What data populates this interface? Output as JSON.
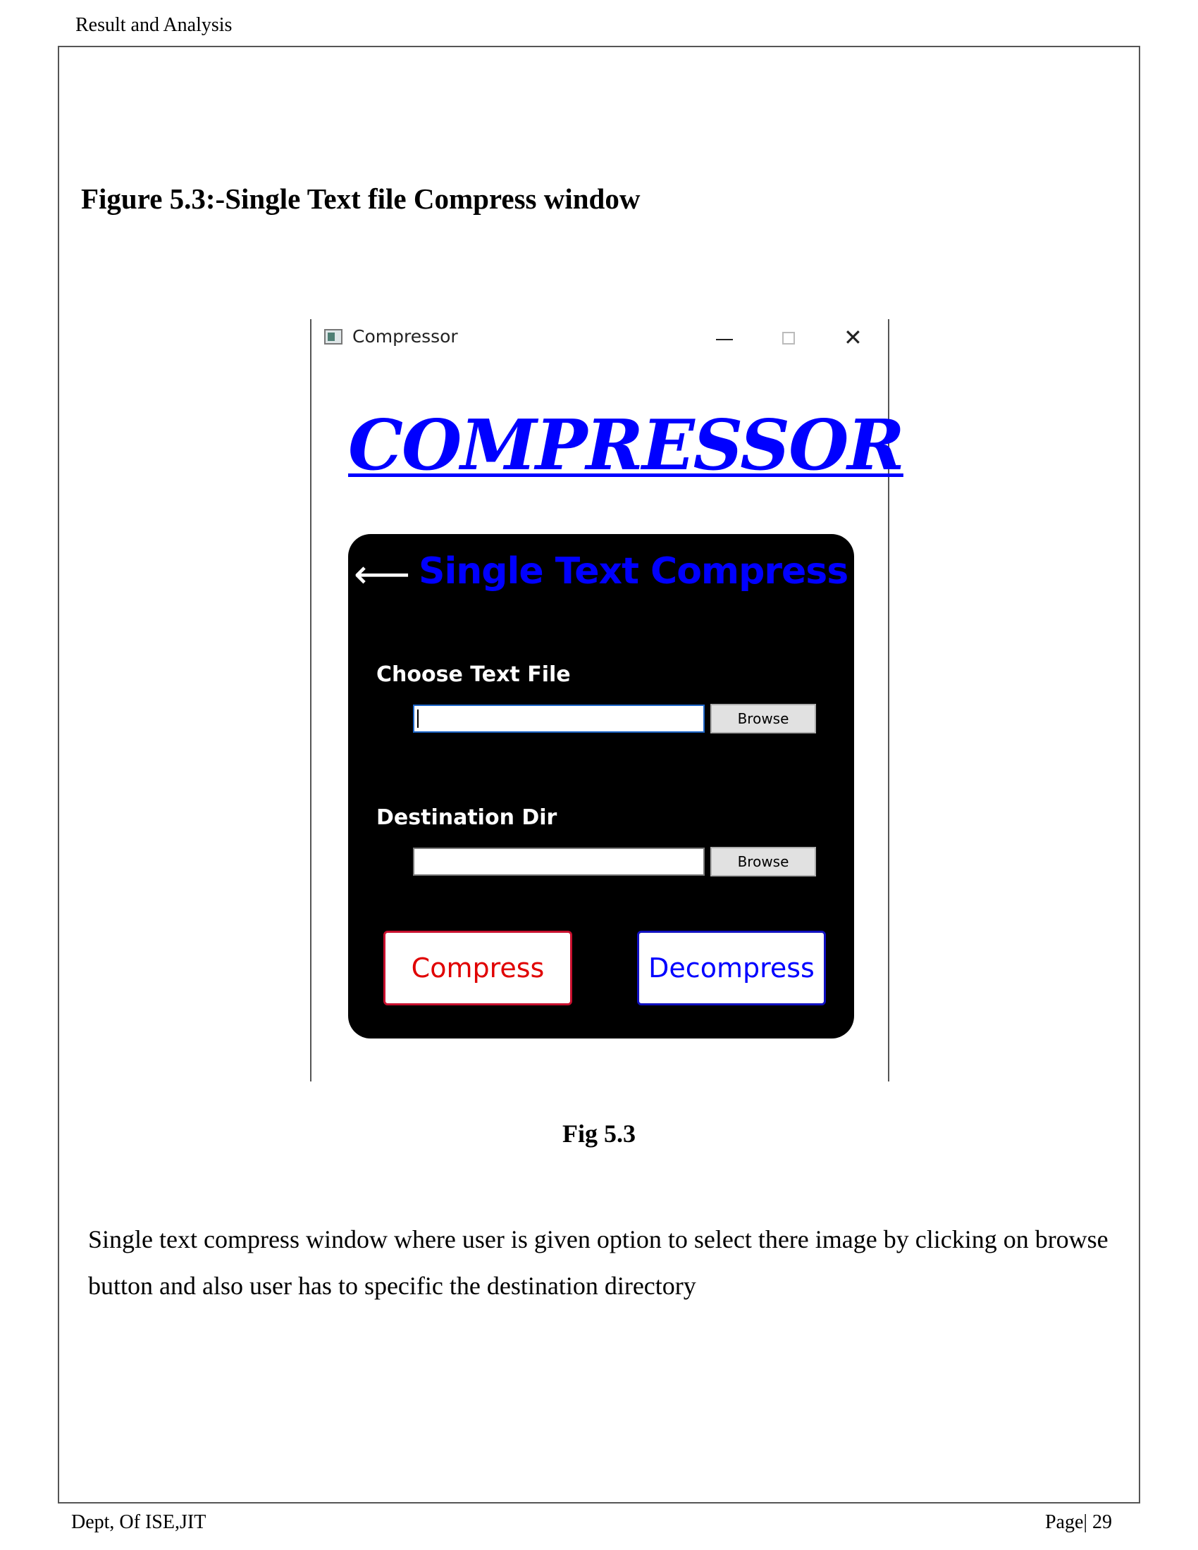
{
  "page": {
    "header": "Result and Analysis",
    "figure_heading": "Figure 5.3:-Single Text file Compress window",
    "caption": "Fig 5.3",
    "body_text": "Single text compress window where user is given option to select there image by clicking on browse button and also user has to specific the destination directory",
    "footer_left": "Dept, Of ISE,JIT",
    "footer_right": "Page| 29"
  },
  "window": {
    "title": "Compressor",
    "controls": {
      "minimize": "–",
      "maximize": "□",
      "close": "✕"
    },
    "brand": "COMPRESSOR",
    "panel": {
      "back_arrow": "⟵",
      "title": "Single Text Compress",
      "choose_label": "Choose Text File",
      "choose_value": "",
      "browse_label": "Browse",
      "dest_label": "Destination Dir",
      "dest_value": "",
      "compress_label": "Compress",
      "decompress_label": "Decompress"
    }
  },
  "colors": {
    "brand": "#0000ff",
    "panel_bg": "#000000",
    "compress": "#e00000",
    "decompress": "#0000ff"
  }
}
